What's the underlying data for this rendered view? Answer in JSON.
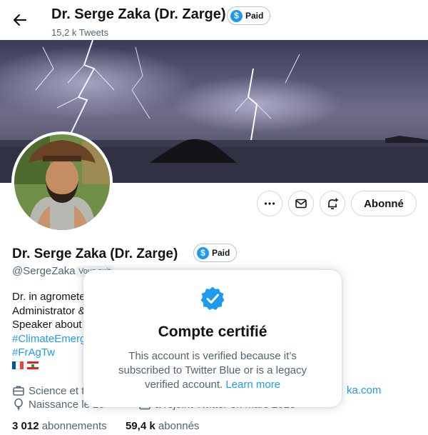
{
  "header": {
    "name": "Dr. Serge Zaka (Dr. Zarge)",
    "paid_label": "Paid",
    "tweet_count": "15,2 k Tweets"
  },
  "profile": {
    "name": "Dr. Serge Zaka (Dr. Zarge)",
    "paid_label": "Paid",
    "handle": "@SergeZaka",
    "follows_you": "Vous suit",
    "bio_lines": [
      "Dr. in agromete",
      "Administrator &",
      "Speaker about"
    ],
    "bio_hashtags": [
      "#ClimateEmerg",
      "#FrAgTw"
    ],
    "category": "Science et t",
    "birth": "Naissance le 25 ",
    "joined": "a rejoint Twitter en mars 2013",
    "website": "ka.com",
    "following_count": "3 012",
    "following_label": "abonnements",
    "followers_count": "59,4 k",
    "followers_label": "abonnés"
  },
  "actions": {
    "more_icon": "more-icon",
    "message_icon": "envelope-icon",
    "notify_icon": "bell-plus-icon",
    "follow_label": "Abonné"
  },
  "popup": {
    "title": "Compte certifié",
    "body_text": "This account is verified because it’s subscribed to Twitter Blue or is a legacy verified account. ",
    "learn_more": "Learn more"
  },
  "colors": {
    "accent": "#1d9bf0",
    "text": "#0f1419",
    "secondary": "#536471",
    "border": "#cfd9de"
  }
}
